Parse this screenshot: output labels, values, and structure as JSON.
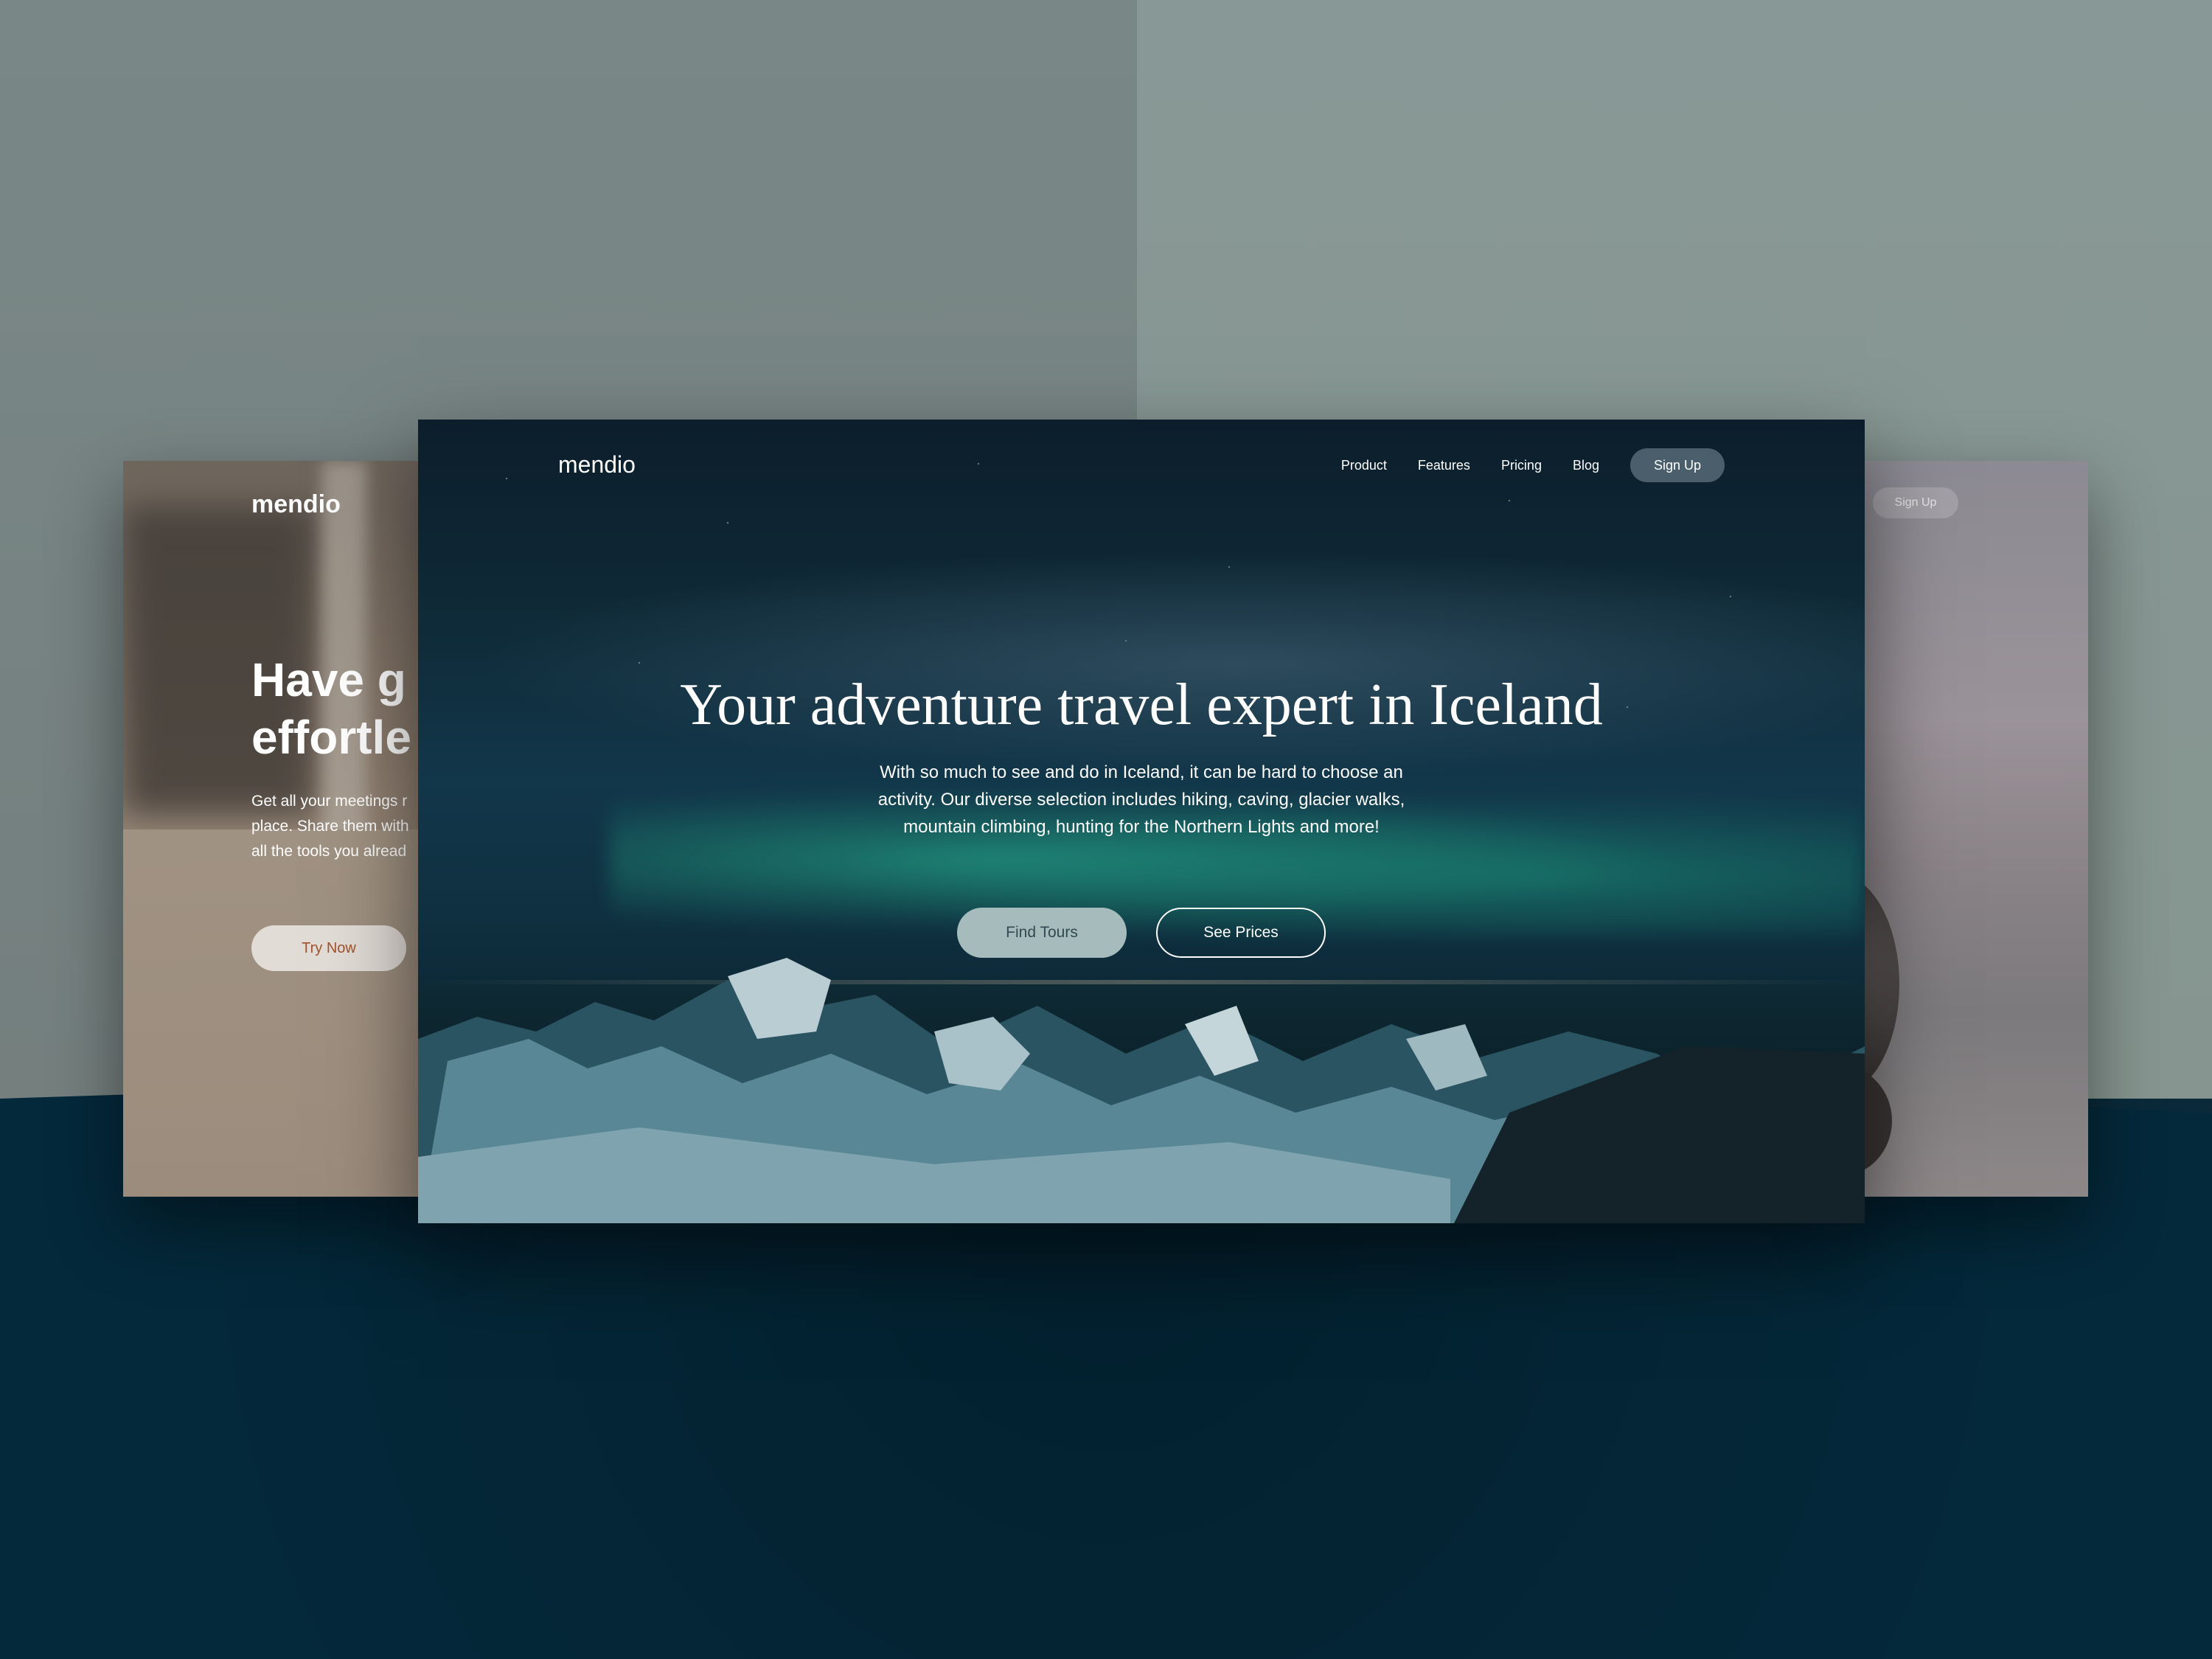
{
  "left_card": {
    "logo": "mendio",
    "headline_line1": "Have g",
    "headline_line2": "effortle",
    "body": "Get all your meetings r\nplace. Share them with\nall the tools you alread",
    "cta": "Try Now"
  },
  "right_card": {
    "signup": "Sign Up"
  },
  "main_card": {
    "logo": "mendio",
    "nav": [
      "Product",
      "Features",
      "Pricing",
      "Blog"
    ],
    "signup": "Sign Up",
    "title": "Your adventure travel expert in Iceland",
    "body": "With so much to see and do in Iceland, it can be hard to choose an activity. Our diverse selection includes hiking, caving, glacier walks, mountain climbing, hunting for the Northern Lights and more!",
    "buttons": [
      "Find Tours",
      "See Prices"
    ]
  },
  "colors": {
    "wall_left": "#798887",
    "wall_right": "#889896",
    "floor": "#04293b",
    "aurora": "#28be96",
    "nav_signup_bg": "#4a5e6b",
    "find_tours_bg": "#a6bcbc",
    "try_now_text": "#a0522d"
  }
}
